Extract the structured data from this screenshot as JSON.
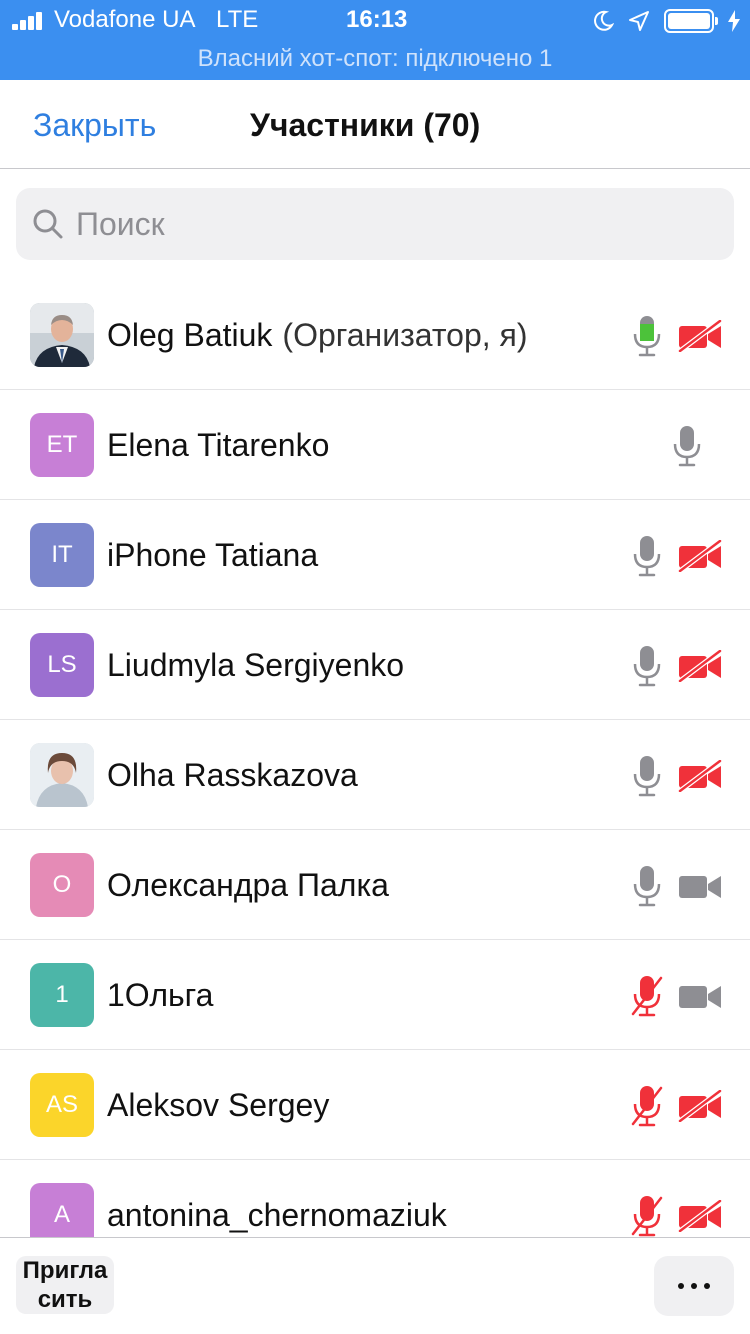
{
  "status_bar": {
    "carrier": "Vodafone UA",
    "network": "LTE",
    "time": "16:13",
    "hotspot_text": "Власний хот-спот: підключено 1",
    "background_color": "#3b8ff0"
  },
  "nav": {
    "close_label": "Закрыть",
    "title": "Участники (70)"
  },
  "search": {
    "placeholder": "Поиск"
  },
  "participants": [
    {
      "name": "Oleg Batiuk",
      "role": "(Организатор, я)",
      "initials": "",
      "avatar": "photo",
      "avatar_color": "#9aa4ae",
      "mic": "active",
      "video": "off"
    },
    {
      "name": "Elena Titarenko",
      "role": "",
      "initials": "ET",
      "avatar": "initials",
      "avatar_color": "#c77fd6",
      "mic": "on",
      "video": "none"
    },
    {
      "name": "iPhone Tatiana",
      "role": "",
      "initials": "IT",
      "avatar": "initials",
      "avatar_color": "#7b86cc",
      "mic": "on",
      "video": "off"
    },
    {
      "name": "Liudmyla Sergiyenko",
      "role": "",
      "initials": "LS",
      "avatar": "initials",
      "avatar_color": "#9b6fd0",
      "mic": "on",
      "video": "off"
    },
    {
      "name": "Olha Rasskazova",
      "role": "",
      "initials": "",
      "avatar": "photo",
      "avatar_color": "#cfd6dc",
      "mic": "on",
      "video": "off"
    },
    {
      "name": "Олександра Палка",
      "role": "",
      "initials": "О",
      "avatar": "initials",
      "avatar_color": "#e58bb6",
      "mic": "on",
      "video": "on"
    },
    {
      "name": "1Ольга",
      "role": "",
      "initials": "1",
      "avatar": "initials",
      "avatar_color": "#4cb6a8",
      "mic": "muted",
      "video": "on"
    },
    {
      "name": "Aleksov Sergey",
      "role": "",
      "initials": "AS",
      "avatar": "initials",
      "avatar_color": "#fbd52a",
      "mic": "muted",
      "video": "off"
    },
    {
      "name": "antonina_chernomaziuk",
      "role": "",
      "initials": "A",
      "avatar": "initials",
      "avatar_color": "#c77fd6",
      "mic": "muted",
      "video": "off"
    }
  ],
  "bottom": {
    "invite_label": "Пригласить"
  },
  "colors": {
    "accent": "#2f7fe0",
    "mic_active": "#4cc23a",
    "icon_gray": "#8e8e93",
    "muted_red": "#f0313a"
  },
  "icons": {
    "mic": "microphone-icon",
    "mic_muted": "microphone-muted-icon",
    "video": "video-camera-icon",
    "video_off": "video-camera-off-icon",
    "search": "search-icon",
    "more": "more-dots-icon"
  }
}
